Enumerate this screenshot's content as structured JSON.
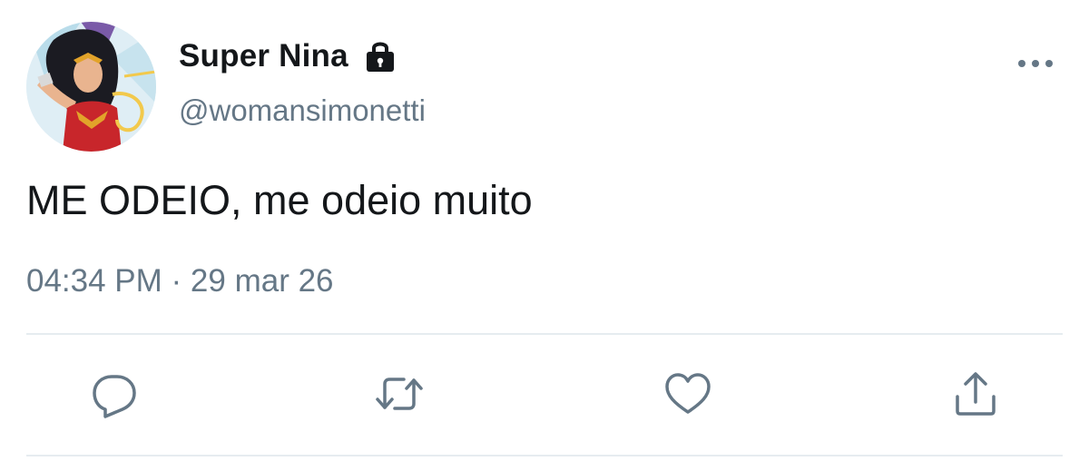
{
  "tweet": {
    "display_name": "Super Nina",
    "handle": "@womansimonetti",
    "text": "ME ODEIO, me odeio muito",
    "timestamp": "04:34 PM · 29 mar 26",
    "protected": true
  },
  "icons": {
    "avatar": "avatar-image",
    "lock": "lock-icon",
    "more": "more-options-icon",
    "reply": "reply-icon",
    "retweet": "retweet-icon",
    "like": "heart-icon",
    "share": "share-icon"
  },
  "colors": {
    "text_primary": "#14171a",
    "text_secondary": "#657786",
    "icon": "#657786",
    "divider": "#e6ecf0"
  }
}
